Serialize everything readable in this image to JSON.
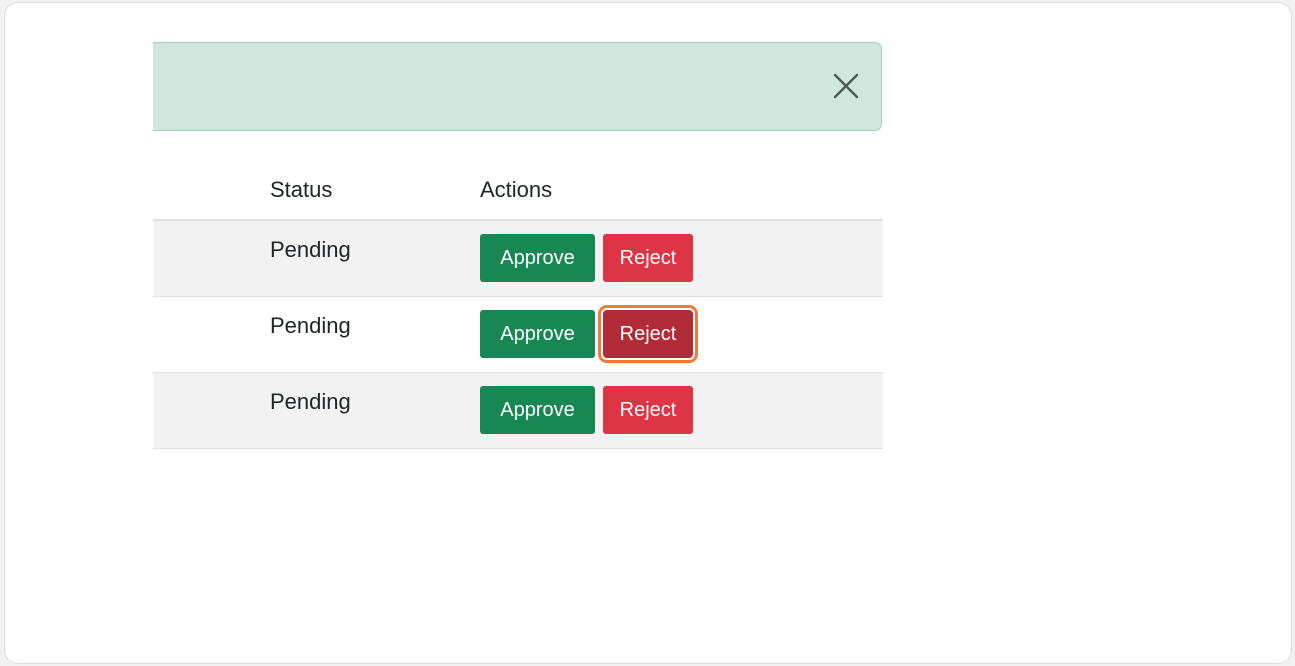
{
  "alert": {
    "close_icon": "close-icon",
    "background": "#d1e7dd"
  },
  "table": {
    "columns": {
      "status": "Status",
      "actions": "Actions"
    },
    "rows": [
      {
        "status": "Pending",
        "approve_label": "Approve",
        "reject_label": "Reject",
        "reject_state": "default"
      },
      {
        "status": "Pending",
        "approve_label": "Approve",
        "reject_label": "Reject",
        "reject_state": "focused"
      },
      {
        "status": "Pending",
        "approve_label": "Approve",
        "reject_label": "Reject",
        "reject_state": "default"
      }
    ]
  },
  "colors": {
    "approve": "#198754",
    "reject": "#dc3545",
    "reject_active": "#b02a37",
    "focus_ring": "#f07a3c"
  }
}
